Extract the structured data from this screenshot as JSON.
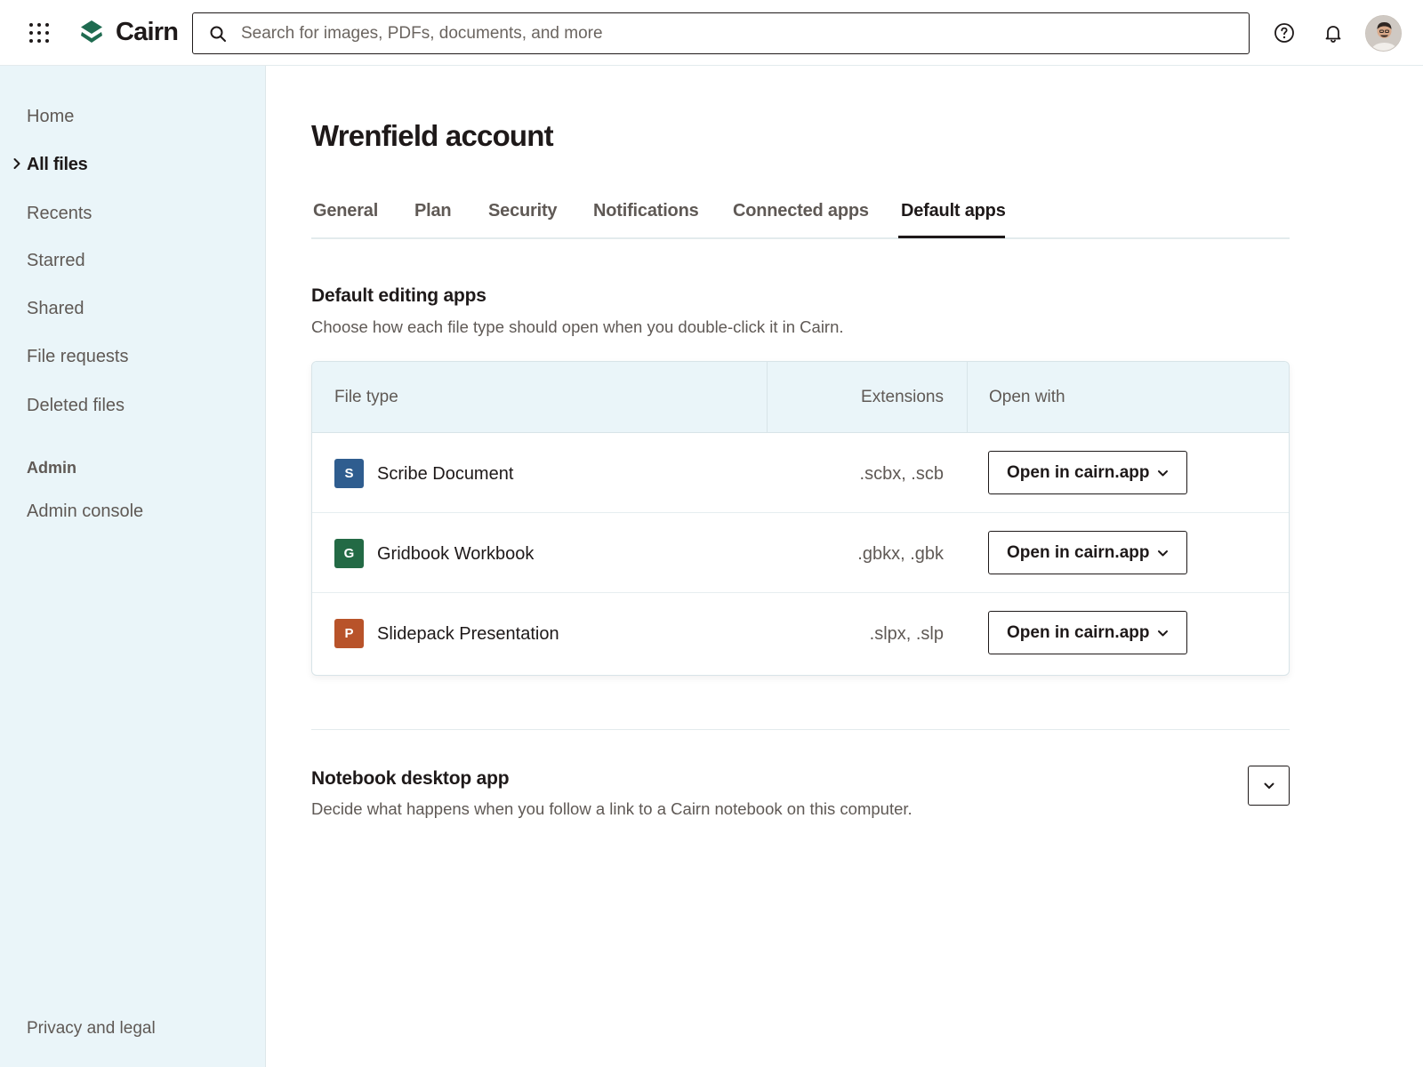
{
  "header": {
    "brand": "Cairn",
    "search_placeholder": "Search for images, PDFs, documents, and more",
    "icons": [
      "app-grid-icon",
      "cairn-logo-icon",
      "search-icon",
      "help-icon",
      "bell-icon"
    ]
  },
  "sidebar": {
    "items": [
      {
        "label": "Home"
      },
      {
        "label": "All files",
        "active": true
      },
      {
        "label": "Recents"
      },
      {
        "label": "Starred"
      },
      {
        "label": "Shared"
      },
      {
        "label": "File requests"
      },
      {
        "label": "Deleted files"
      }
    ],
    "admin_heading": "Admin",
    "admin_items": [
      {
        "label": "Admin console"
      }
    ],
    "footer_link": "Privacy and legal"
  },
  "main": {
    "title": "Wrenfield account",
    "tabs": [
      {
        "label": "General"
      },
      {
        "label": "Plan"
      },
      {
        "label": "Security"
      },
      {
        "label": "Notifications"
      },
      {
        "label": "Connected apps"
      },
      {
        "label": "Default apps",
        "active": true
      }
    ],
    "editing": {
      "title": "Default editing apps",
      "description": "Choose how each file type should open when you double-click it in Cairn.",
      "columns": [
        "File type",
        "Extensions",
        "Open with"
      ],
      "rows": [
        {
          "icon_letter": "S",
          "icon_color": "#2f5d8f",
          "name": "Scribe Document",
          "extensions": ".scbx, .scb",
          "open_with": "Open in cairn.app"
        },
        {
          "icon_letter": "G",
          "icon_color": "#236a45",
          "name": "Gridbook Workbook",
          "extensions": ".gbkx, .gbk",
          "open_with": "Open in cairn.app"
        },
        {
          "icon_letter": "P",
          "icon_color": "#b8532a",
          "name": "Slidepack Presentation",
          "extensions": ".slpx, .slp",
          "open_with": "Open in cairn.app"
        }
      ]
    },
    "notebook": {
      "title": "Notebook desktop app",
      "description": "Decide what happens when you follow a link to a Cairn notebook on this computer."
    }
  },
  "colors": {
    "sidebar_bg": "#eaf5f9",
    "text_primary": "#1e1919",
    "text_secondary": "#5f5955",
    "brand_green": "#1f6b50"
  }
}
